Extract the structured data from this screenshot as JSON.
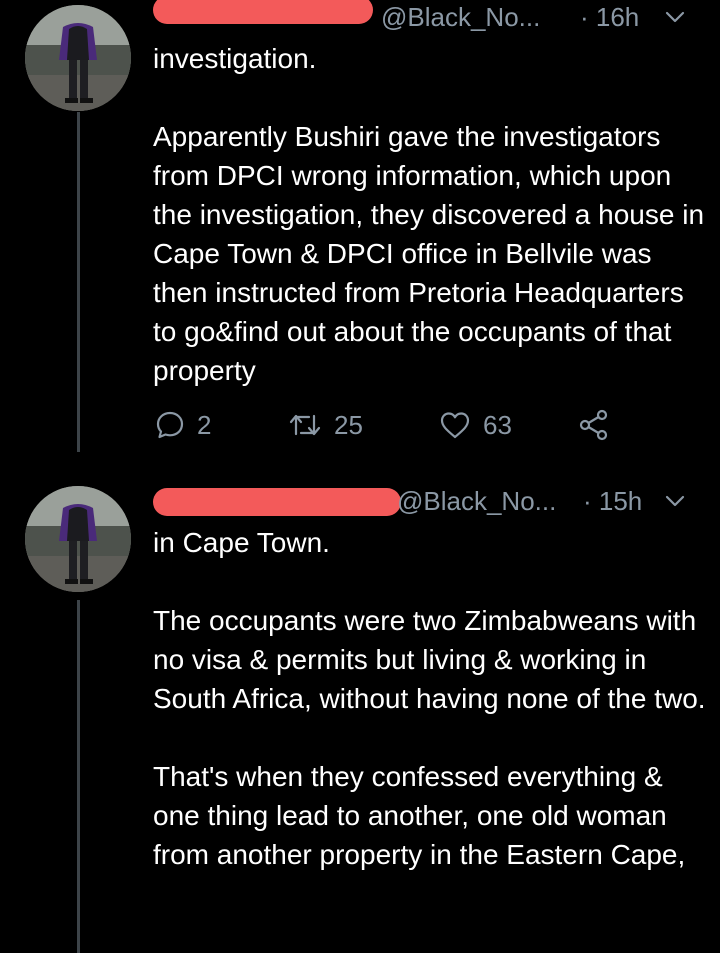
{
  "colors": {
    "background": "#000000",
    "text": "#ffffff",
    "muted": "#8b98a5",
    "thread_line": "#3d4449",
    "redaction": "#f35a5a"
  },
  "tweets": [
    {
      "handle": "@Black_No...",
      "time": "· 16h",
      "paragraphs": [
        "investigation.",
        "Apparently Bushiri gave the investigators from DPCI wrong information, which upon the investigation, they discovered a house in Cape Town & DPCI office in Bellvile was then instructed from Pretoria Headquarters to go&find out about the occupants of that property"
      ],
      "actions": {
        "replies": "2",
        "retweets": "25",
        "likes": "63"
      },
      "icons": [
        "reply-icon",
        "retweet-icon",
        "like-icon",
        "share-icon",
        "chevron-down-icon"
      ]
    },
    {
      "handle": "@Black_No...",
      "time": "· 15h",
      "paragraphs": [
        "in Cape Town.",
        "The occupants were two Zimbabweans with no visa & permits but living & working in South Africa, without having none of the two.",
        "That's when they confessed everything & one thing lead to another, one old woman from another property in the Eastern Cape,"
      ],
      "icons": [
        "chevron-down-icon"
      ]
    }
  ]
}
